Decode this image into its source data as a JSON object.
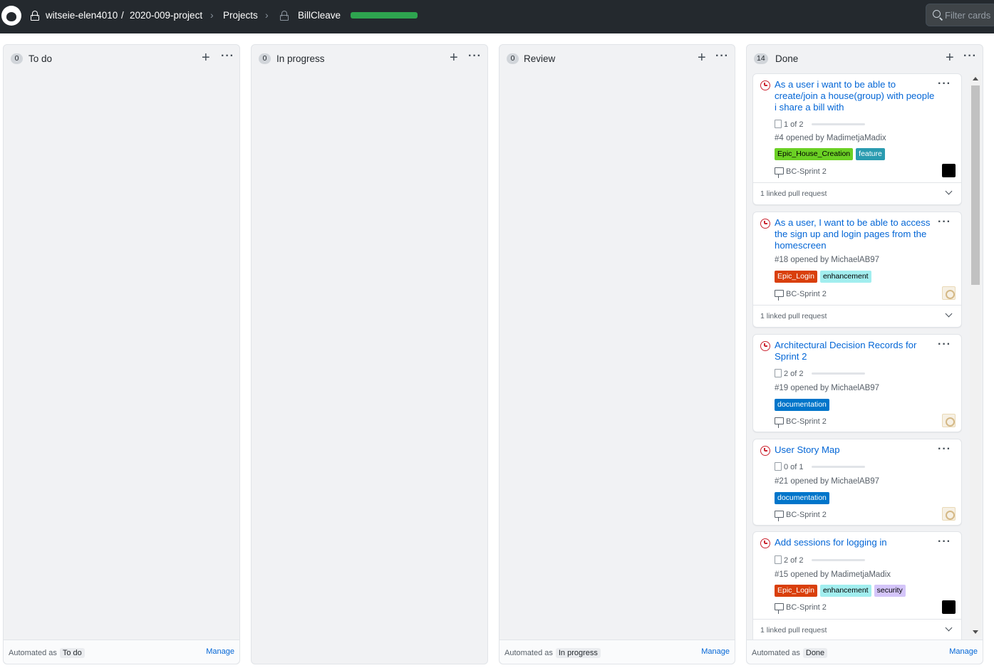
{
  "header": {
    "owner": "witseie-elen4010",
    "slash": "/",
    "repo": "2020-009-project",
    "projects": "Projects",
    "project_name": "BillCleave",
    "progress_percent": 100,
    "filter_placeholder": "Filter cards"
  },
  "columns": [
    {
      "name": "To do",
      "count": "0",
      "automated": "Automated as",
      "state": "To do",
      "manage": "Manage"
    },
    {
      "name": "In progress",
      "count": "0"
    },
    {
      "name": "Review",
      "count": "0",
      "automated": "Automated as",
      "state": "In progress",
      "manage": "Manage"
    },
    {
      "name": "Done",
      "count": "14",
      "automated": "Automated as",
      "state": "Done",
      "manage": "Manage"
    }
  ],
  "cards": [
    {
      "title": "As a user i want to be able to create/join a house(group) with people i share a bill with",
      "tasks": "1 of 2",
      "task_fraction": 0.5,
      "opened": "#4 opened by MadimetjaMadix",
      "labels": [
        {
          "text": "Epic_House_Creation",
          "bg": "#6bd024",
          "fg": "#000000"
        },
        {
          "text": "feature",
          "bg": "#2a9bb0",
          "fg": "#ffffff"
        }
      ],
      "milestone": "BC-Sprint 2",
      "avatar": "dark",
      "linked": "1 linked pull request"
    },
    {
      "title": "As a user, I want to be able to access the sign up and login pages from the homescreen",
      "opened": "#18 opened by MichaelAB97",
      "labels": [
        {
          "text": "Epic_Login",
          "bg": "#d93f0b",
          "fg": "#ffffff"
        },
        {
          "text": "enhancement",
          "bg": "#a2eeef",
          "fg": "#000000"
        }
      ],
      "milestone": "BC-Sprint 2",
      "avatar": "light",
      "linked": "1 linked pull request"
    },
    {
      "title": "Architectural Decision Records for Sprint 2",
      "tasks": "2 of 2",
      "task_fraction": 1,
      "opened": "#19 opened by MichaelAB97",
      "labels": [
        {
          "text": "documentation",
          "bg": "#0075ca",
          "fg": "#ffffff"
        }
      ],
      "milestone": "BC-Sprint 2",
      "avatar": "light"
    },
    {
      "title": "User Story Map",
      "tasks": "0 of 1",
      "task_fraction": 0,
      "opened": "#21 opened by MichaelAB97",
      "labels": [
        {
          "text": "documentation",
          "bg": "#0075ca",
          "fg": "#ffffff"
        }
      ],
      "milestone": "BC-Sprint 2",
      "avatar": "light"
    },
    {
      "title": "Add sessions for logging in",
      "tasks": "2 of 2",
      "task_fraction": 1,
      "opened": "#15 opened by MadimetjaMadix",
      "labels": [
        {
          "text": "Epic_Login",
          "bg": "#d93f0b",
          "fg": "#ffffff"
        },
        {
          "text": "enhancement",
          "bg": "#a2eeef",
          "fg": "#000000"
        },
        {
          "text": "security",
          "bg": "#d4c5f9",
          "fg": "#000000"
        }
      ],
      "milestone": "BC-Sprint 2",
      "avatar": "dark",
      "linked": "1 linked pull request"
    }
  ]
}
